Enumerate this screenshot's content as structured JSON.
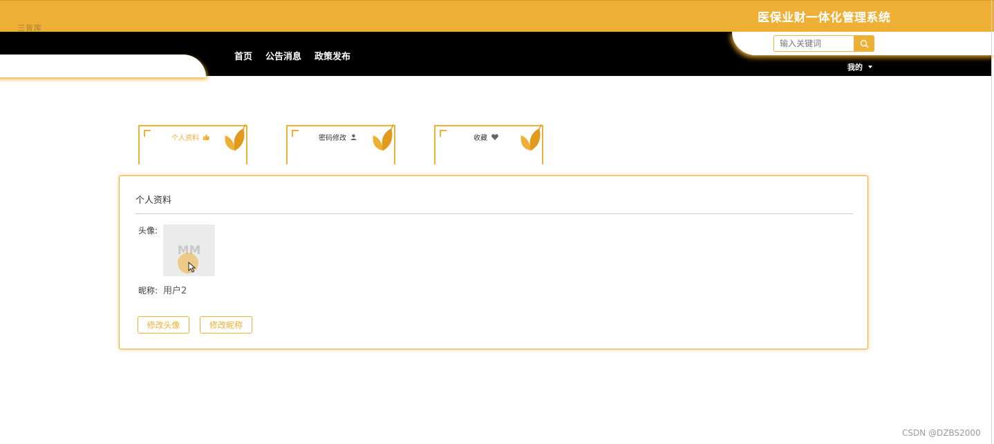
{
  "header": {
    "site_title": "医保业财一体化管理系统",
    "top_left_text": "三皆库"
  },
  "nav": {
    "items": [
      {
        "label": "首页"
      },
      {
        "label": "公告消息"
      },
      {
        "label": "政策发布"
      }
    ]
  },
  "search": {
    "placeholder": "输入关键词",
    "icon": "search-icon"
  },
  "user_menu": {
    "label": "我的"
  },
  "tabs": [
    {
      "label": "个人资料",
      "icon": "thumbs-up-icon",
      "active": true
    },
    {
      "label": "密码修改",
      "icon": "user-icon",
      "active": false
    },
    {
      "label": "收藏",
      "icon": "heart-icon",
      "active": false
    }
  ],
  "profile": {
    "title": "个人资料",
    "avatar_label": "头像:",
    "avatar_placeholder": "MM",
    "nickname_label": "昵称:",
    "nickname_value": "用户2",
    "change_avatar_button": "修改头像",
    "change_nickname_button": "修改昵称"
  },
  "watermark": "CSDN @DZBS2000",
  "colors": {
    "accent": "#eeaf35",
    "nav_background": "#000000"
  }
}
